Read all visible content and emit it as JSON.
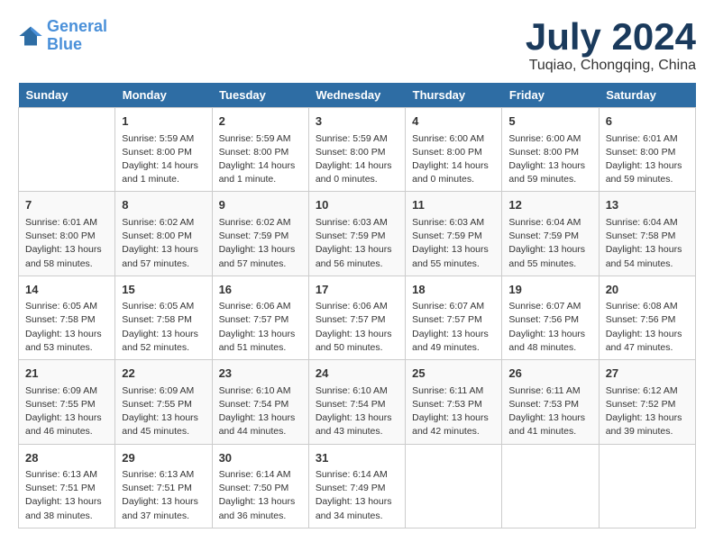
{
  "header": {
    "logo_line1": "General",
    "logo_line2": "Blue",
    "month": "July 2024",
    "location": "Tuqiao, Chongqing, China"
  },
  "days_of_week": [
    "Sunday",
    "Monday",
    "Tuesday",
    "Wednesday",
    "Thursday",
    "Friday",
    "Saturday"
  ],
  "weeks": [
    [
      {
        "day": "",
        "info": ""
      },
      {
        "day": "1",
        "info": "Sunrise: 5:59 AM\nSunset: 8:00 PM\nDaylight: 14 hours\nand 1 minute."
      },
      {
        "day": "2",
        "info": "Sunrise: 5:59 AM\nSunset: 8:00 PM\nDaylight: 14 hours\nand 1 minute."
      },
      {
        "day": "3",
        "info": "Sunrise: 5:59 AM\nSunset: 8:00 PM\nDaylight: 14 hours\nand 0 minutes."
      },
      {
        "day": "4",
        "info": "Sunrise: 6:00 AM\nSunset: 8:00 PM\nDaylight: 14 hours\nand 0 minutes."
      },
      {
        "day": "5",
        "info": "Sunrise: 6:00 AM\nSunset: 8:00 PM\nDaylight: 13 hours\nand 59 minutes."
      },
      {
        "day": "6",
        "info": "Sunrise: 6:01 AM\nSunset: 8:00 PM\nDaylight: 13 hours\nand 59 minutes."
      }
    ],
    [
      {
        "day": "7",
        "info": "Sunrise: 6:01 AM\nSunset: 8:00 PM\nDaylight: 13 hours\nand 58 minutes."
      },
      {
        "day": "8",
        "info": "Sunrise: 6:02 AM\nSunset: 8:00 PM\nDaylight: 13 hours\nand 57 minutes."
      },
      {
        "day": "9",
        "info": "Sunrise: 6:02 AM\nSunset: 7:59 PM\nDaylight: 13 hours\nand 57 minutes."
      },
      {
        "day": "10",
        "info": "Sunrise: 6:03 AM\nSunset: 7:59 PM\nDaylight: 13 hours\nand 56 minutes."
      },
      {
        "day": "11",
        "info": "Sunrise: 6:03 AM\nSunset: 7:59 PM\nDaylight: 13 hours\nand 55 minutes."
      },
      {
        "day": "12",
        "info": "Sunrise: 6:04 AM\nSunset: 7:59 PM\nDaylight: 13 hours\nand 55 minutes."
      },
      {
        "day": "13",
        "info": "Sunrise: 6:04 AM\nSunset: 7:58 PM\nDaylight: 13 hours\nand 54 minutes."
      }
    ],
    [
      {
        "day": "14",
        "info": "Sunrise: 6:05 AM\nSunset: 7:58 PM\nDaylight: 13 hours\nand 53 minutes."
      },
      {
        "day": "15",
        "info": "Sunrise: 6:05 AM\nSunset: 7:58 PM\nDaylight: 13 hours\nand 52 minutes."
      },
      {
        "day": "16",
        "info": "Sunrise: 6:06 AM\nSunset: 7:57 PM\nDaylight: 13 hours\nand 51 minutes."
      },
      {
        "day": "17",
        "info": "Sunrise: 6:06 AM\nSunset: 7:57 PM\nDaylight: 13 hours\nand 50 minutes."
      },
      {
        "day": "18",
        "info": "Sunrise: 6:07 AM\nSunset: 7:57 PM\nDaylight: 13 hours\nand 49 minutes."
      },
      {
        "day": "19",
        "info": "Sunrise: 6:07 AM\nSunset: 7:56 PM\nDaylight: 13 hours\nand 48 minutes."
      },
      {
        "day": "20",
        "info": "Sunrise: 6:08 AM\nSunset: 7:56 PM\nDaylight: 13 hours\nand 47 minutes."
      }
    ],
    [
      {
        "day": "21",
        "info": "Sunrise: 6:09 AM\nSunset: 7:55 PM\nDaylight: 13 hours\nand 46 minutes."
      },
      {
        "day": "22",
        "info": "Sunrise: 6:09 AM\nSunset: 7:55 PM\nDaylight: 13 hours\nand 45 minutes."
      },
      {
        "day": "23",
        "info": "Sunrise: 6:10 AM\nSunset: 7:54 PM\nDaylight: 13 hours\nand 44 minutes."
      },
      {
        "day": "24",
        "info": "Sunrise: 6:10 AM\nSunset: 7:54 PM\nDaylight: 13 hours\nand 43 minutes."
      },
      {
        "day": "25",
        "info": "Sunrise: 6:11 AM\nSunset: 7:53 PM\nDaylight: 13 hours\nand 42 minutes."
      },
      {
        "day": "26",
        "info": "Sunrise: 6:11 AM\nSunset: 7:53 PM\nDaylight: 13 hours\nand 41 minutes."
      },
      {
        "day": "27",
        "info": "Sunrise: 6:12 AM\nSunset: 7:52 PM\nDaylight: 13 hours\nand 39 minutes."
      }
    ],
    [
      {
        "day": "28",
        "info": "Sunrise: 6:13 AM\nSunset: 7:51 PM\nDaylight: 13 hours\nand 38 minutes."
      },
      {
        "day": "29",
        "info": "Sunrise: 6:13 AM\nSunset: 7:51 PM\nDaylight: 13 hours\nand 37 minutes."
      },
      {
        "day": "30",
        "info": "Sunrise: 6:14 AM\nSunset: 7:50 PM\nDaylight: 13 hours\nand 36 minutes."
      },
      {
        "day": "31",
        "info": "Sunrise: 6:14 AM\nSunset: 7:49 PM\nDaylight: 13 hours\nand 34 minutes."
      },
      {
        "day": "",
        "info": ""
      },
      {
        "day": "",
        "info": ""
      },
      {
        "day": "",
        "info": ""
      }
    ]
  ]
}
